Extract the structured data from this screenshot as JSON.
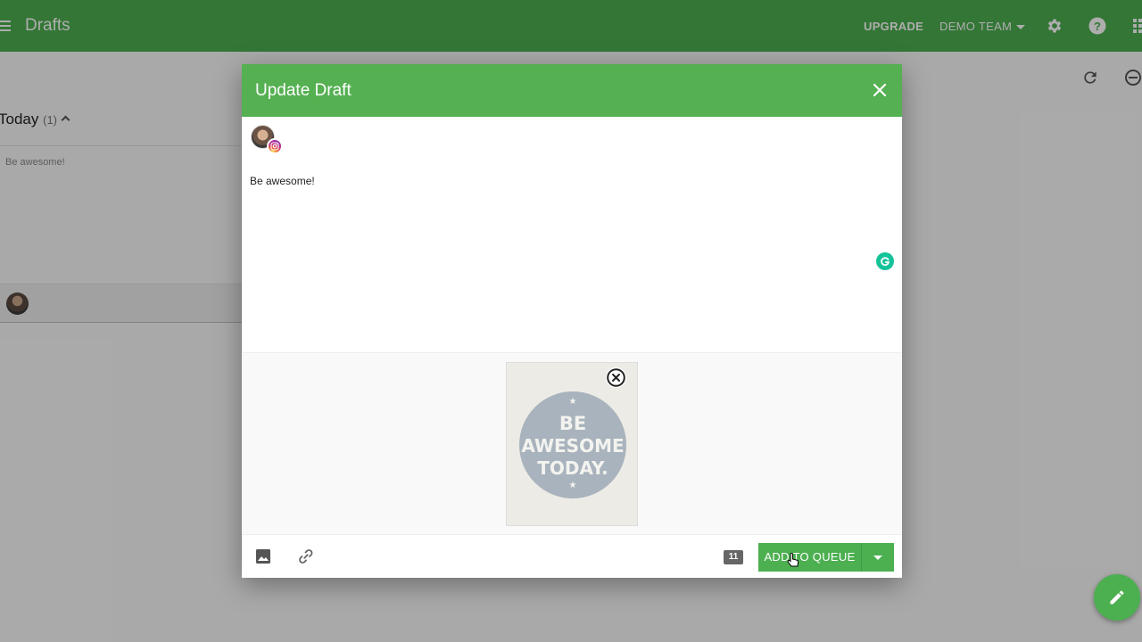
{
  "app": {
    "title": "Drafts",
    "upgrade_label": "UPGRADE",
    "team_label": "DEMO TEAM",
    "brand_color": "#4caf50",
    "icons": [
      "menu-icon",
      "settings-gear-icon",
      "help-icon",
      "apps-grid-icon",
      "refresh-icon",
      "minus-circle-icon",
      "edit-pencil-icon"
    ]
  },
  "background_list": {
    "section_title": "Today",
    "section_count": "(1)",
    "card_text": "Be awesome!"
  },
  "modal": {
    "title": "Update Draft",
    "post_text": "Be awesome!",
    "network": "instagram",
    "image": {
      "lines": [
        "BE",
        "AWESOME",
        "TODAY."
      ]
    },
    "char_count": "11",
    "primary_button": "ADD TO QUEUE"
  }
}
